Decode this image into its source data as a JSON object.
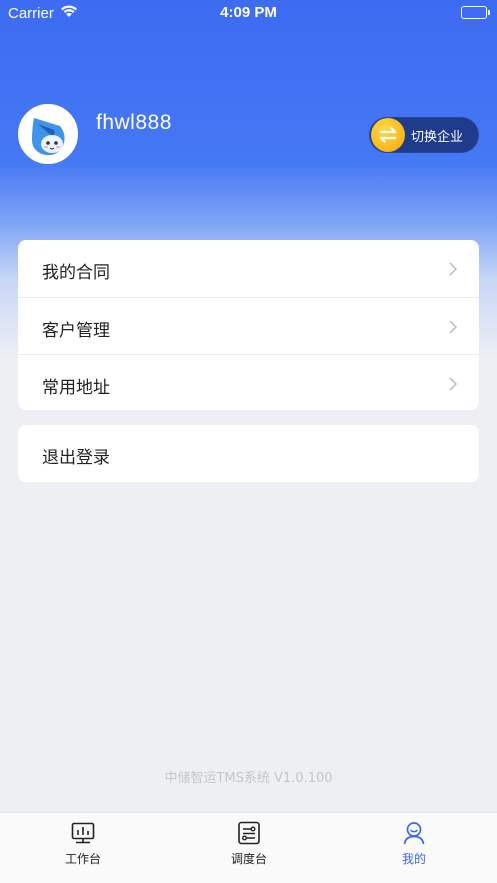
{
  "status_bar": {
    "carrier": "Carrier",
    "time": "4:09 PM"
  },
  "profile": {
    "username": "fhwl888",
    "switch_label": "切换企业"
  },
  "menu": {
    "items": [
      {
        "label": "我的合同"
      },
      {
        "label": "客户管理"
      },
      {
        "label": "常用地址"
      }
    ],
    "logout_label": "退出登录"
  },
  "version_text": "中储智运TMS系统 V1.0.100",
  "tabbar": {
    "tabs": [
      {
        "label": "工作台",
        "icon": "monitor-icon"
      },
      {
        "label": "调度台",
        "icon": "dispatch-icon"
      },
      {
        "label": "我的",
        "icon": "user-icon",
        "active": true
      }
    ]
  },
  "colors": {
    "accent": "#3B68E8",
    "hero_top": "#3D6BF2",
    "switch_bg": "#1F3C8C",
    "coin": "#F7B619"
  }
}
